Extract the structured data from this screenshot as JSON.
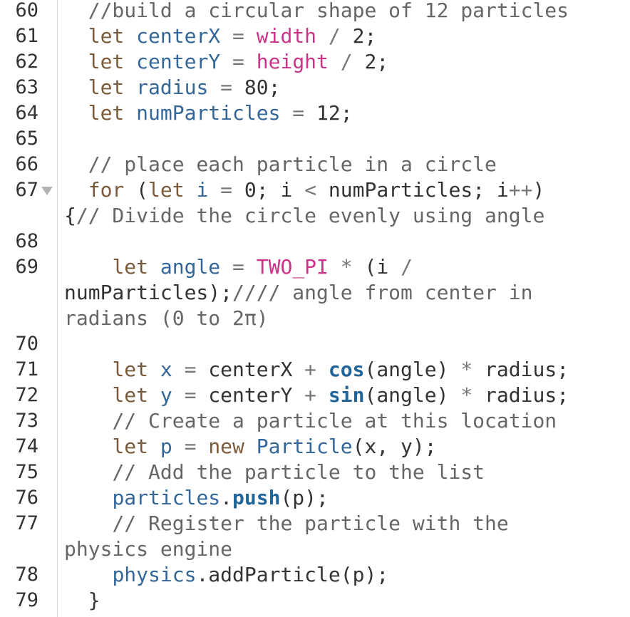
{
  "editor": {
    "lines": [
      {
        "number": "60",
        "segments": [
          {
            "text": "  ",
            "class": "pl"
          },
          {
            "text": "//build a circular shape of 12 particles",
            "class": "cm"
          }
        ]
      },
      {
        "number": "61",
        "segments": [
          {
            "text": "  ",
            "class": "pl"
          },
          {
            "text": "let",
            "class": "kw"
          },
          {
            "text": " ",
            "class": "pl"
          },
          {
            "text": "centerX",
            "class": "vr"
          },
          {
            "text": " = ",
            "class": "op"
          },
          {
            "text": "width",
            "class": "bi"
          },
          {
            "text": " / ",
            "class": "op"
          },
          {
            "text": "2;",
            "class": "pl"
          }
        ]
      },
      {
        "number": "62",
        "segments": [
          {
            "text": "  ",
            "class": "pl"
          },
          {
            "text": "let",
            "class": "kw"
          },
          {
            "text": " ",
            "class": "pl"
          },
          {
            "text": "centerY",
            "class": "vr"
          },
          {
            "text": " = ",
            "class": "op"
          },
          {
            "text": "height",
            "class": "bi"
          },
          {
            "text": " / ",
            "class": "op"
          },
          {
            "text": "2;",
            "class": "pl"
          }
        ]
      },
      {
        "number": "63",
        "segments": [
          {
            "text": "  ",
            "class": "pl"
          },
          {
            "text": "let",
            "class": "kw"
          },
          {
            "text": " ",
            "class": "pl"
          },
          {
            "text": "radius",
            "class": "vr"
          },
          {
            "text": " = ",
            "class": "op"
          },
          {
            "text": "80;",
            "class": "pl"
          }
        ]
      },
      {
        "number": "64",
        "segments": [
          {
            "text": "  ",
            "class": "pl"
          },
          {
            "text": "let",
            "class": "kw"
          },
          {
            "text": " ",
            "class": "pl"
          },
          {
            "text": "numParticles",
            "class": "vr"
          },
          {
            "text": " = ",
            "class": "op"
          },
          {
            "text": "12;",
            "class": "pl"
          }
        ]
      },
      {
        "number": "65",
        "segments": []
      },
      {
        "number": "66",
        "segments": [
          {
            "text": "  ",
            "class": "pl"
          },
          {
            "text": "// place each particle in a circle",
            "class": "cm"
          }
        ]
      },
      {
        "number": "67",
        "fold": true,
        "segments": [
          {
            "text": "  ",
            "class": "pl"
          },
          {
            "text": "for",
            "class": "kw"
          },
          {
            "text": " (",
            "class": "pl"
          },
          {
            "text": "let",
            "class": "kw"
          },
          {
            "text": " ",
            "class": "pl"
          },
          {
            "text": "i",
            "class": "vr"
          },
          {
            "text": " = ",
            "class": "op"
          },
          {
            "text": "0; i ",
            "class": "pl"
          },
          {
            "text": "<",
            "class": "op"
          },
          {
            "text": " numParticles; i",
            "class": "pl"
          },
          {
            "text": "++",
            "class": "op"
          },
          {
            "text": ")\n{",
            "class": "pl"
          },
          {
            "text": "// Divide the circle evenly using angle",
            "class": "cm"
          }
        ]
      },
      {
        "number": "68",
        "segments": []
      },
      {
        "number": "69",
        "segments": [
          {
            "text": "    ",
            "class": "pl"
          },
          {
            "text": "let",
            "class": "kw"
          },
          {
            "text": " ",
            "class": "pl"
          },
          {
            "text": "angle",
            "class": "vr"
          },
          {
            "text": " = ",
            "class": "op"
          },
          {
            "text": "TWO_PI",
            "class": "bi"
          },
          {
            "text": " * ",
            "class": "op"
          },
          {
            "text": "(i ",
            "class": "pl"
          },
          {
            "text": "/",
            "class": "op"
          },
          {
            "text": "\nnumParticles);",
            "class": "pl"
          },
          {
            "text": "//// angle from center in\nradians (0 to 2π)",
            "class": "cm"
          }
        ]
      },
      {
        "number": "70",
        "segments": []
      },
      {
        "number": "71",
        "segments": [
          {
            "text": "    ",
            "class": "pl"
          },
          {
            "text": "let",
            "class": "kw"
          },
          {
            "text": " ",
            "class": "pl"
          },
          {
            "text": "x",
            "class": "vr"
          },
          {
            "text": " = ",
            "class": "op"
          },
          {
            "text": "centerX ",
            "class": "pl"
          },
          {
            "text": "+",
            "class": "op"
          },
          {
            "text": " ",
            "class": "pl"
          },
          {
            "text": "cos",
            "class": "fn"
          },
          {
            "text": "(angle) ",
            "class": "pl"
          },
          {
            "text": "*",
            "class": "op"
          },
          {
            "text": " radius;",
            "class": "pl"
          }
        ]
      },
      {
        "number": "72",
        "segments": [
          {
            "text": "    ",
            "class": "pl"
          },
          {
            "text": "let",
            "class": "kw"
          },
          {
            "text": " ",
            "class": "pl"
          },
          {
            "text": "y",
            "class": "vr"
          },
          {
            "text": " = ",
            "class": "op"
          },
          {
            "text": "centerY ",
            "class": "pl"
          },
          {
            "text": "+",
            "class": "op"
          },
          {
            "text": " ",
            "class": "pl"
          },
          {
            "text": "sin",
            "class": "fn"
          },
          {
            "text": "(angle) ",
            "class": "pl"
          },
          {
            "text": "*",
            "class": "op"
          },
          {
            "text": " radius;",
            "class": "pl"
          }
        ]
      },
      {
        "number": "73",
        "segments": [
          {
            "text": "    ",
            "class": "pl"
          },
          {
            "text": "// Create a particle at this location",
            "class": "cm"
          }
        ]
      },
      {
        "number": "74",
        "segments": [
          {
            "text": "    ",
            "class": "pl"
          },
          {
            "text": "let",
            "class": "kw"
          },
          {
            "text": " ",
            "class": "pl"
          },
          {
            "text": "p",
            "class": "vr"
          },
          {
            "text": " = ",
            "class": "op"
          },
          {
            "text": "new",
            "class": "kw"
          },
          {
            "text": " ",
            "class": "pl"
          },
          {
            "text": "Particle",
            "class": "vr"
          },
          {
            "text": "(x, y);",
            "class": "pl"
          }
        ]
      },
      {
        "number": "75",
        "segments": [
          {
            "text": "    ",
            "class": "pl"
          },
          {
            "text": "// Add the particle to the list",
            "class": "cm"
          }
        ]
      },
      {
        "number": "76",
        "segments": [
          {
            "text": "    ",
            "class": "pl"
          },
          {
            "text": "particles",
            "class": "vr"
          },
          {
            "text": ".",
            "class": "pl"
          },
          {
            "text": "push",
            "class": "fn"
          },
          {
            "text": "(p);",
            "class": "pl"
          }
        ]
      },
      {
        "number": "77",
        "segments": [
          {
            "text": "    ",
            "class": "pl"
          },
          {
            "text": "// Register the particle with the\nphysics engine",
            "class": "cm"
          }
        ]
      },
      {
        "number": "78",
        "segments": [
          {
            "text": "    ",
            "class": "pl"
          },
          {
            "text": "physics",
            "class": "vr"
          },
          {
            "text": ".addParticle(p);",
            "class": "pl"
          }
        ]
      },
      {
        "number": "79",
        "segments": [
          {
            "text": "  }",
            "class": "pl"
          }
        ]
      }
    ]
  }
}
